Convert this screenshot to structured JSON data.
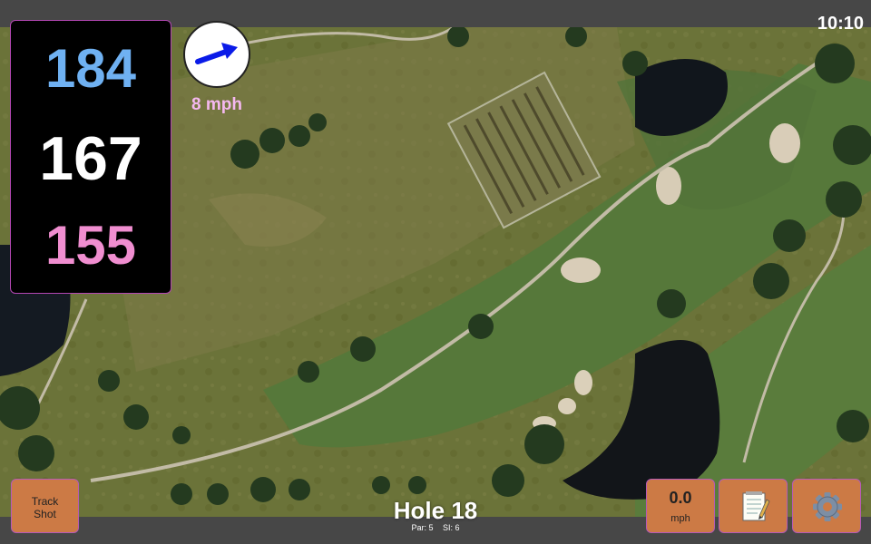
{
  "status": {
    "time": "10:10"
  },
  "distances": {
    "back": "184",
    "middle": "167",
    "front": "155",
    "colors": {
      "back": "#6fb1f2",
      "middle": "#ffffff",
      "front": "#f08ed0",
      "panel_border": "#b347b3"
    }
  },
  "wind": {
    "speed": "8 mph",
    "icon": "arrow-icon",
    "color": "#f5b8f0",
    "arrow_color": "#0a1be8"
  },
  "buttons": {
    "track_shot": "Track\nShot",
    "speed_value": "0.0",
    "speed_unit": "mph",
    "notes_icon": "notepad-icon",
    "settings_icon": "gear-icon",
    "color": "#cc7a45"
  },
  "hole": {
    "title": "Hole 18",
    "par": "Par: 5",
    "si": "SI: 6"
  }
}
